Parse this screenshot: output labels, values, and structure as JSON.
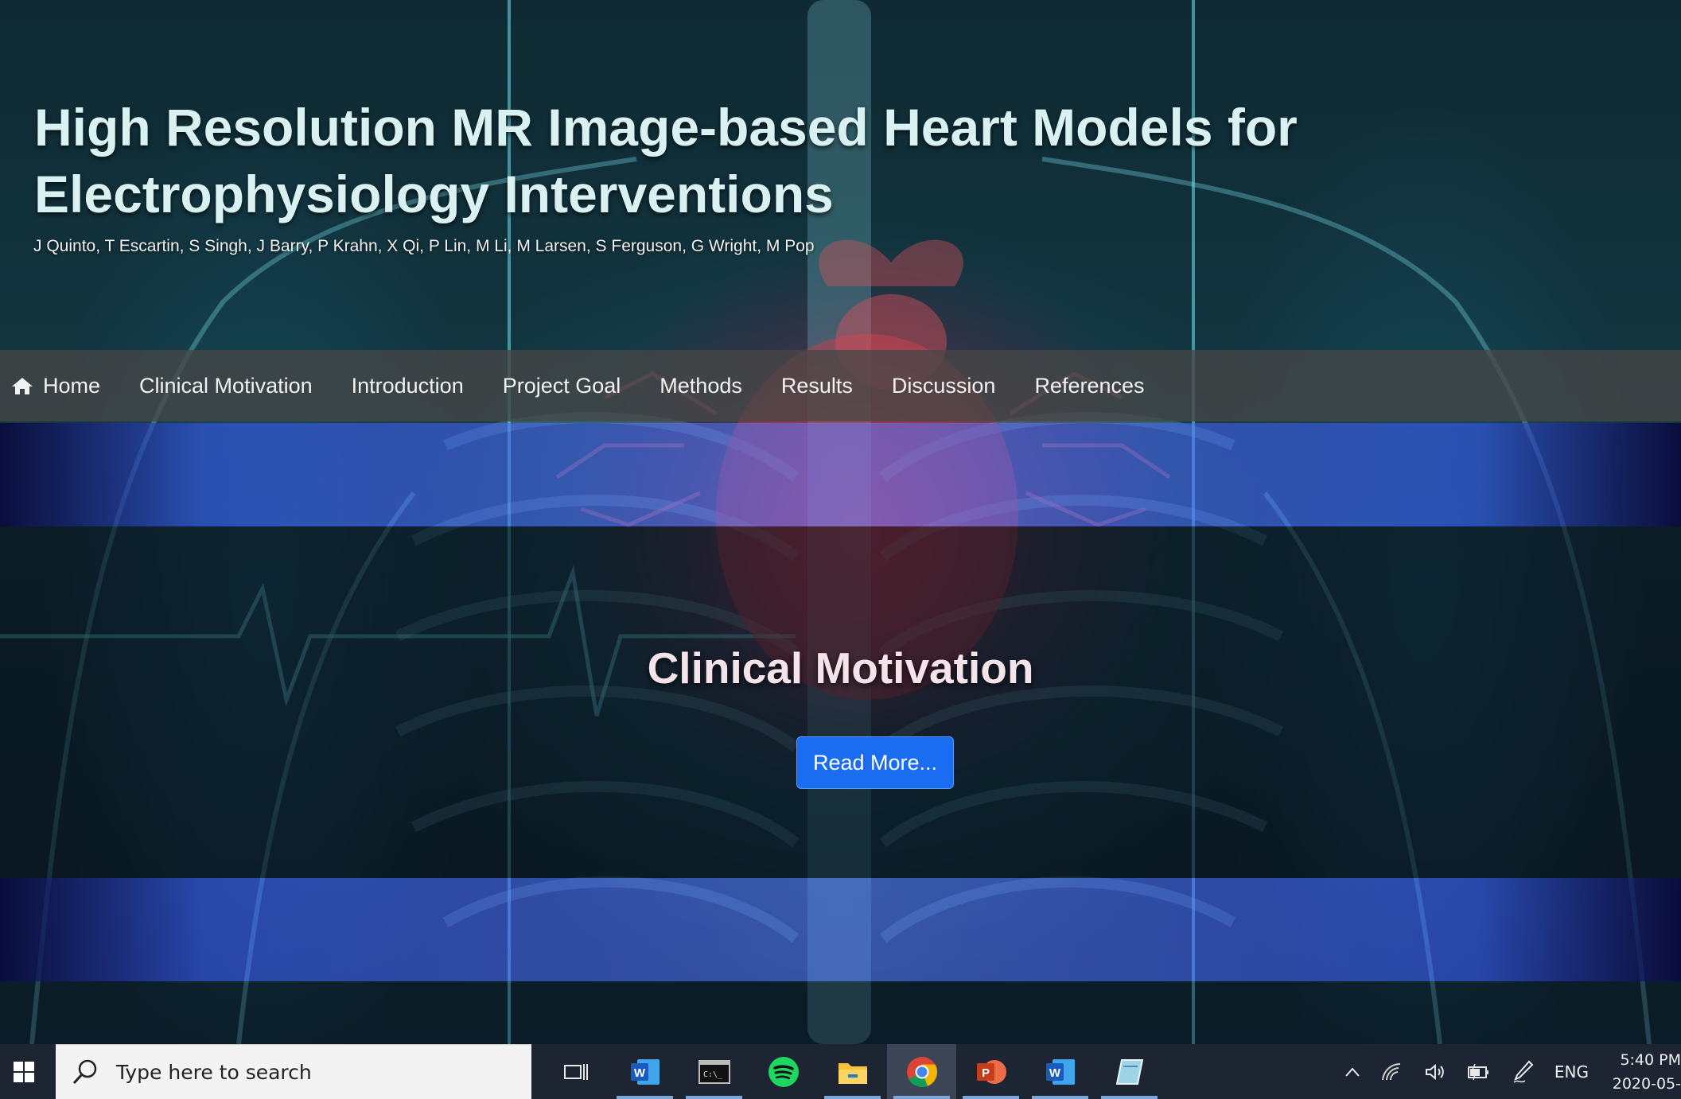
{
  "header": {
    "title": "High Resolution MR Image-based Heart Models for Electrophysiology Interventions",
    "authors": "J Quinto, T Escartin, S Singh, J Barry, P Krahn, X Qi, P Lin, M Li, M Larsen, S Ferguson, G Wright, M Pop"
  },
  "nav": {
    "items": [
      {
        "label": "Home",
        "icon": "home-icon"
      },
      {
        "label": "Clinical Motivation"
      },
      {
        "label": "Introduction"
      },
      {
        "label": "Project Goal"
      },
      {
        "label": "Methods"
      },
      {
        "label": "Results"
      },
      {
        "label": "Discussion"
      },
      {
        "label": "References"
      }
    ]
  },
  "hero": {
    "title": "Clinical Motivation",
    "button_label": "Read More..."
  },
  "taskbar": {
    "search_placeholder": "Type here to search",
    "apps": [
      "task-view-icon",
      "word-icon",
      "terminal-icon",
      "spotify-icon",
      "file-explorer-icon",
      "chrome-icon",
      "powerpoint-icon",
      "word-icon",
      "notes-icon"
    ],
    "tray": {
      "language": "ENG",
      "time": "5:40 PM",
      "date": "2020-05-"
    }
  },
  "colors": {
    "title": "#d9f1f1",
    "nav_bg": "#464646",
    "button": "#1a6cf0",
    "taskbar": "#1d2533"
  }
}
